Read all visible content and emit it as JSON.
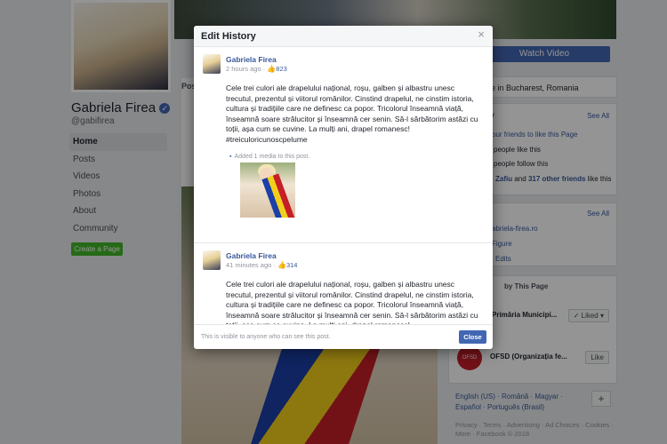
{
  "page": {
    "name": "Gabriela Firea",
    "handle": "@gabifirea",
    "verified_mark": "✓",
    "nav": [
      "Home",
      "Posts",
      "Videos",
      "Photos",
      "About",
      "Community"
    ],
    "create_page": "Create a Page",
    "post_tab_fragment": "Pos",
    "watch_video": "Watch Video",
    "location": "re in Bucharest, Romania",
    "community_title": "ty",
    "see_all": "See All",
    "invite_friends": "our friends to like this Page",
    "people_like": "people like this",
    "people_follow": "people follow this",
    "friends_like_a": "Zafiu",
    "friends_like_b": "and",
    "friends_like_c": "317 other friends",
    "friends_like_d": "like this",
    "about_see_all": "See All",
    "website": "abriela-firea.ro",
    "public_figure": "Figure",
    "edits": "Edits",
    "liked_by": "by This Page",
    "primaria": "Primăria Municipi...",
    "liked_btn": "✓ Liked ▾",
    "ofsd_name": "OFSD (Organizația fe...",
    "ofsd_logo": "OFSD",
    "like_btn": "Like",
    "languages": "English (US) · Română · Magyar · Español · Português (Brasil)",
    "plus": "+",
    "footer": "Privacy · Terms · Advertising · Ad Choices · Cookies · More · Facebook © 2018"
  },
  "modal": {
    "title": "Edit History",
    "close_x": "×",
    "entries": [
      {
        "name": "Gabriela Firea",
        "time": "2 hours ago",
        "separator": "·",
        "likes": "823",
        "text": "Cele trei culori ale drapelului național, roșu, galben și albastru unesc trecutul, prezentul și viitorul românilor. Cinstind drapelul, ne cinstim istoria, cultura și tradițiile care ne definesc ca popor. Tricolorul înseamnă viață, înseamnă soare strălucitor și înseamnă cer senin. Să-l sărbătorim astăzi cu toții, așa cum se cuvine. La mulți ani, drapel romanesc! #treiculoricunoscpelume",
        "added_media": "Added 1 media to this post."
      },
      {
        "name": "Gabriela Firea",
        "time": "41 minutes ago",
        "separator": "·",
        "likes": "314",
        "text": "Cele trei culori ale drapelului național, roșu, galben și albastru unesc trecutul, prezentul și viitorul românilor. Cinstind drapelul, ne cinstim istoria, cultura și tradițiile care ne definesc ca popor. Tricolorul înseamnă viață, înseamnă soare strălucitor și înseamnă cer senin. Să-l sărbătorim astăzi cu toții, așa cum se cuvine. La mulți ani, drapel romanesc!"
      }
    ],
    "visibility_note": "This is visible to anyone who can see this post.",
    "close_button": "Close"
  },
  "colors": {
    "brand_blue": "#4267b2",
    "link_blue": "#385898",
    "create_green": "#42b72a",
    "overlay": "rgba(0,0,0,0.42)"
  }
}
